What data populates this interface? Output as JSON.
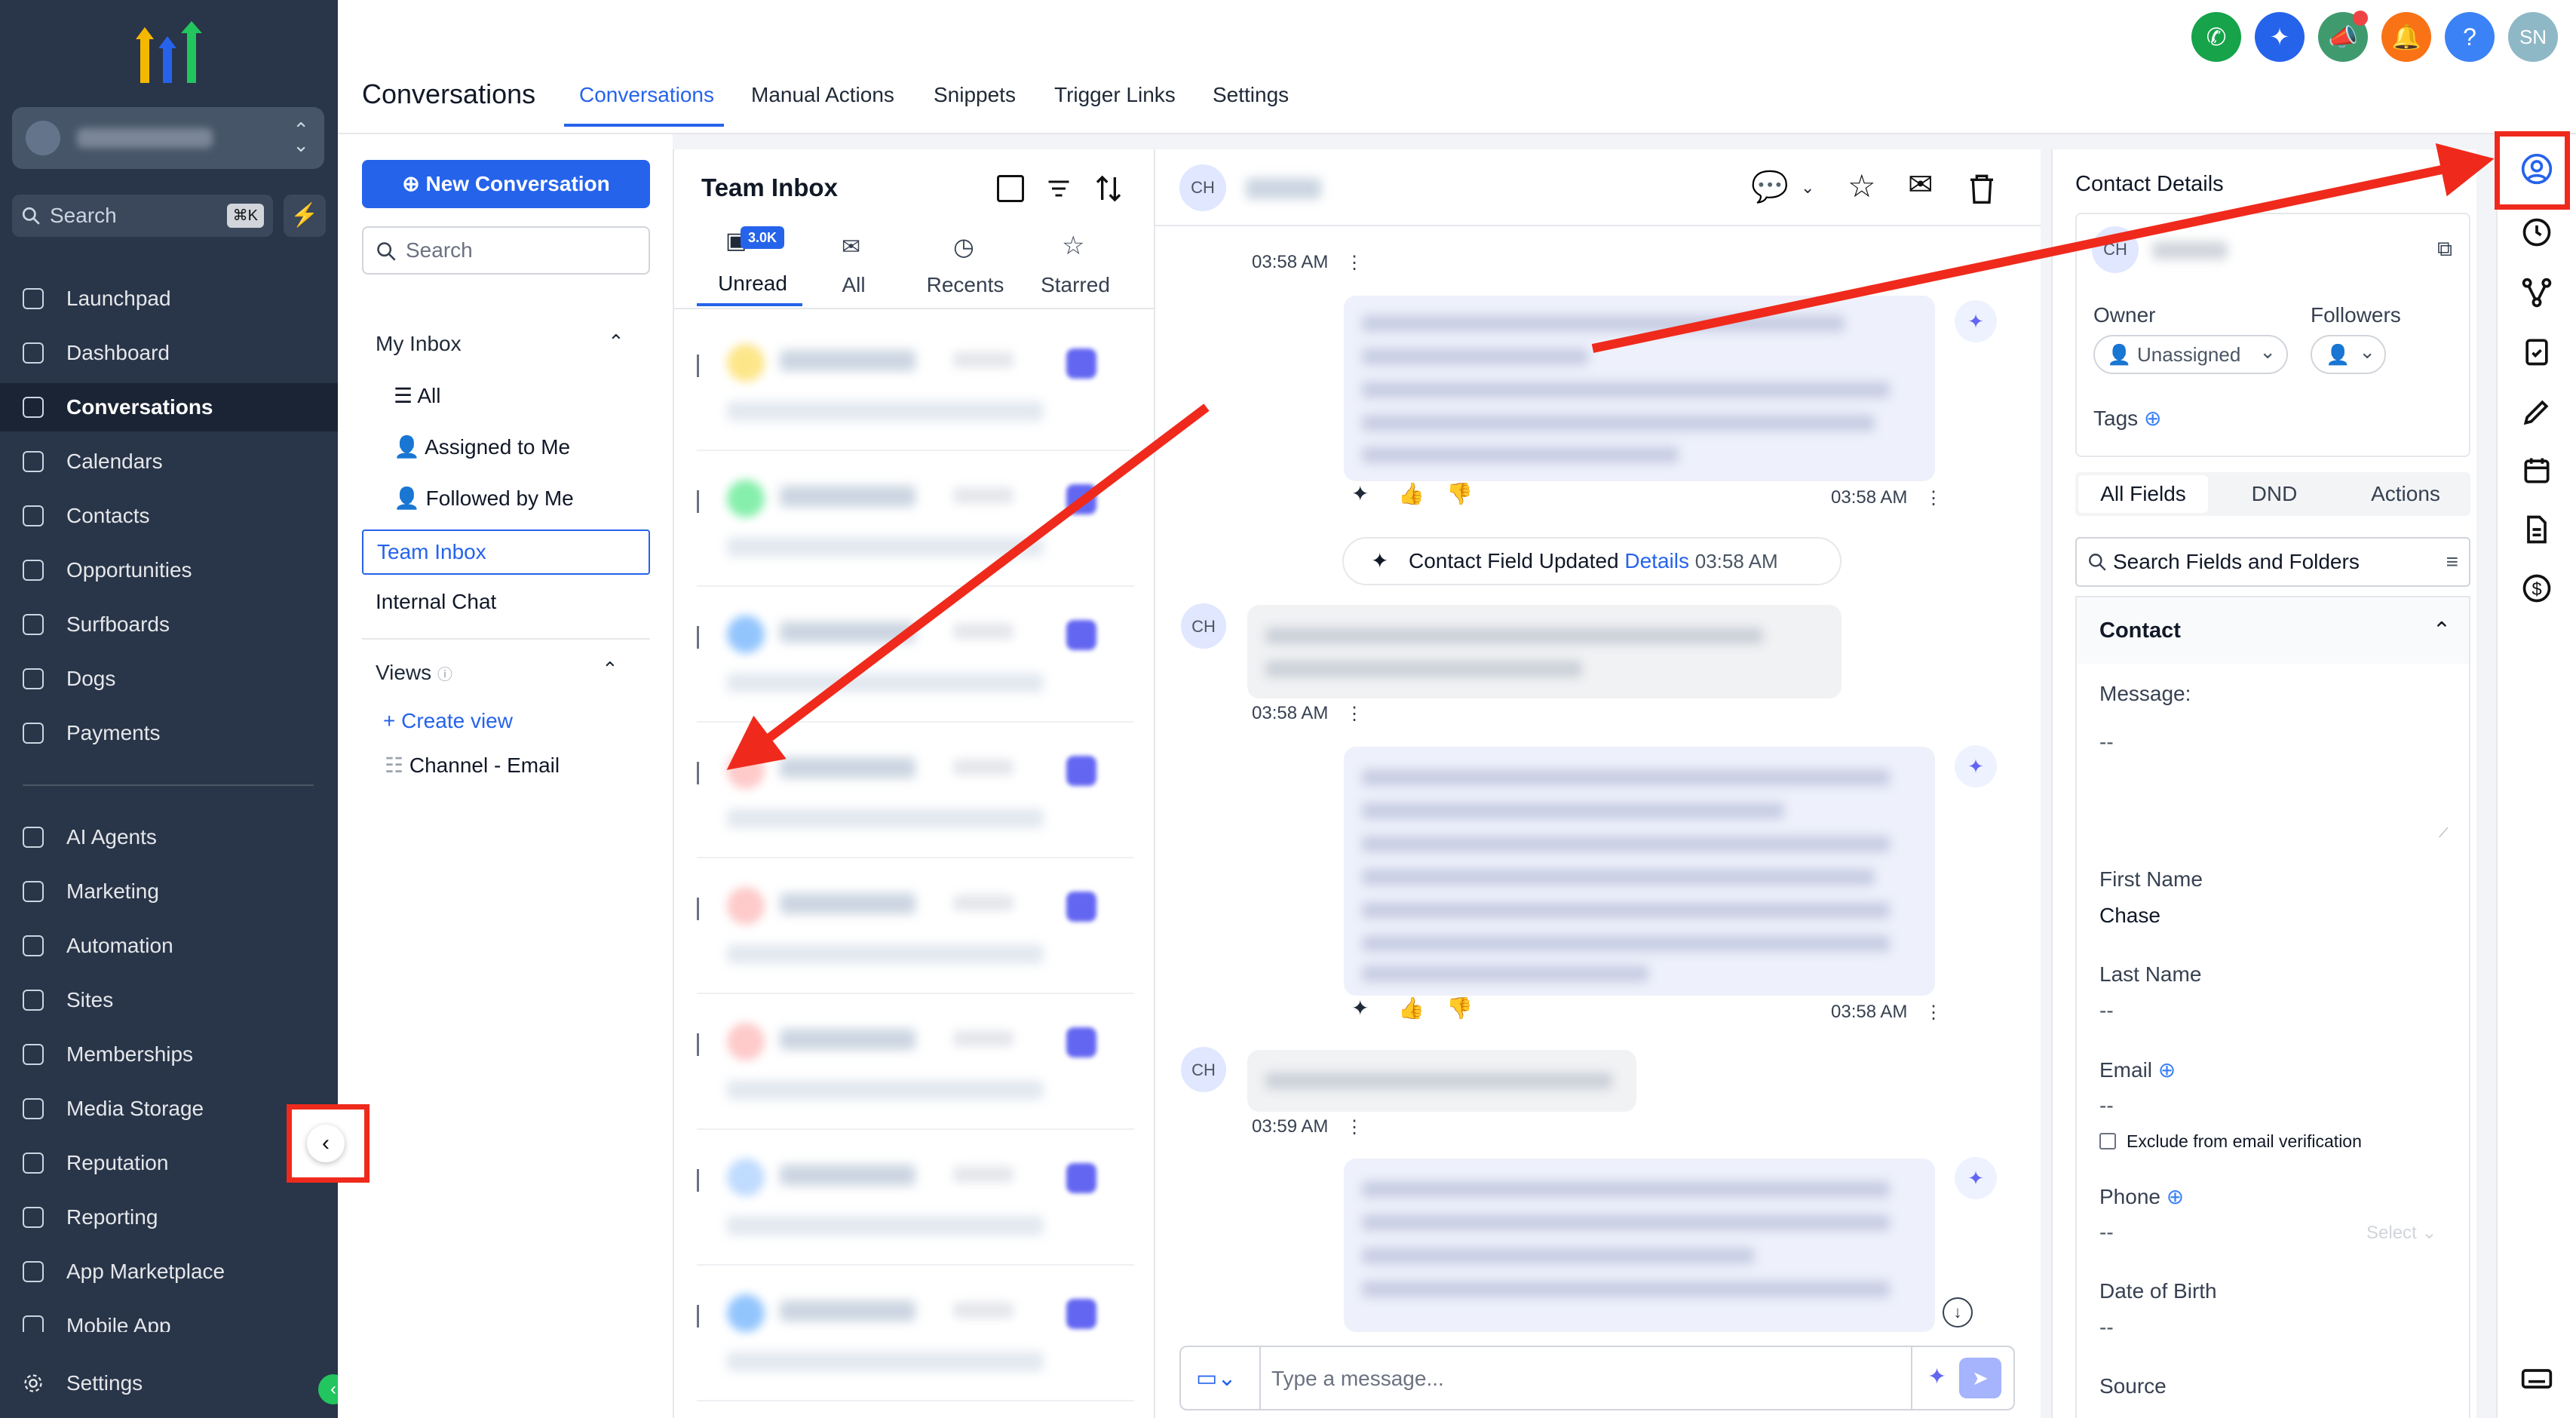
{
  "sidebar": {
    "search_placeholder": "Search",
    "search_shortcut": "⌘K",
    "nav": [
      {
        "label": "Launchpad",
        "icon": "rocket-icon"
      },
      {
        "label": "Dashboard",
        "icon": "grid-icon"
      },
      {
        "label": "Conversations",
        "icon": "chat-icon"
      },
      {
        "label": "Calendars",
        "icon": "calendar-icon"
      },
      {
        "label": "Contacts",
        "icon": "contacts-icon"
      },
      {
        "label": "Opportunities",
        "icon": "opportunities-icon"
      },
      {
        "label": "Surfboards",
        "icon": "surfboard-icon"
      },
      {
        "label": "Dogs",
        "icon": "dog-icon"
      },
      {
        "label": "Payments",
        "icon": "payments-icon"
      }
    ],
    "nav2": [
      {
        "label": "AI Agents",
        "icon": "sparkles-icon"
      },
      {
        "label": "Marketing",
        "icon": "send-icon"
      },
      {
        "label": "Automation",
        "icon": "automation-icon"
      },
      {
        "label": "Sites",
        "icon": "sites-icon"
      },
      {
        "label": "Memberships",
        "icon": "memberships-icon"
      },
      {
        "label": "Media Storage",
        "icon": "image-icon"
      },
      {
        "label": "Reputation",
        "icon": "star-icon"
      },
      {
        "label": "Reporting",
        "icon": "chart-icon"
      },
      {
        "label": "App Marketplace",
        "icon": "apps-icon"
      },
      {
        "label": "Mobile App",
        "icon": "mobile-icon"
      }
    ],
    "settings_label": "Settings"
  },
  "header": {
    "title": "Conversations",
    "tabs": [
      "Conversations",
      "Manual Actions",
      "Snippets",
      "Trigger Links",
      "Settings"
    ],
    "avatar_initials": "SN",
    "help_label": "?"
  },
  "inbox": {
    "new_conversation": "New Conversation",
    "search_placeholder": "Search",
    "my_inbox": "My Inbox",
    "all": "All",
    "assigned": "Assigned to Me",
    "followed": "Followed by Me",
    "team_inbox": "Team Inbox",
    "internal_chat": "Internal Chat",
    "views": "Views",
    "create_view": "Create view",
    "channel_email": "Channel - Email"
  },
  "list": {
    "title": "Team Inbox",
    "badge": "3.0K",
    "tabs": [
      "Unread",
      "All",
      "Recents",
      "Starred"
    ]
  },
  "chat": {
    "avatar": "CH",
    "times": [
      "03:58 AM",
      "03:58 AM",
      "03:58 AM",
      "03:58 AM",
      "03:58 AM",
      "03:59 AM"
    ],
    "event_text": "Contact Field Updated",
    "event_link": "Details",
    "event_time": "03:58 AM",
    "composer_placeholder": "Type a message..."
  },
  "contact": {
    "title": "Contact Details",
    "avatar": "CH",
    "owner_label": "Owner",
    "owner_value": "Unassigned",
    "followers_label": "Followers",
    "tags_label": "Tags",
    "segments": [
      "All Fields",
      "DND",
      "Actions"
    ],
    "field_search_placeholder": "Search Fields and Folders",
    "section": "Contact",
    "message_label": "Message:",
    "message_value": "--",
    "first_name_label": "First Name",
    "first_name_value": "Chase",
    "last_name_label": "Last Name",
    "last_name_value": "--",
    "email_label": "Email",
    "email_value": "--",
    "exclude_label": "Exclude from email verification",
    "phone_label": "Phone",
    "phone_value": "--",
    "phone_select": "Select",
    "dob_label": "Date of Birth",
    "dob_value": "--",
    "source_label": "Source"
  },
  "colors": {
    "sidebar": "#293548",
    "accent": "#2563eb",
    "annotation": "#ef2a1c"
  }
}
